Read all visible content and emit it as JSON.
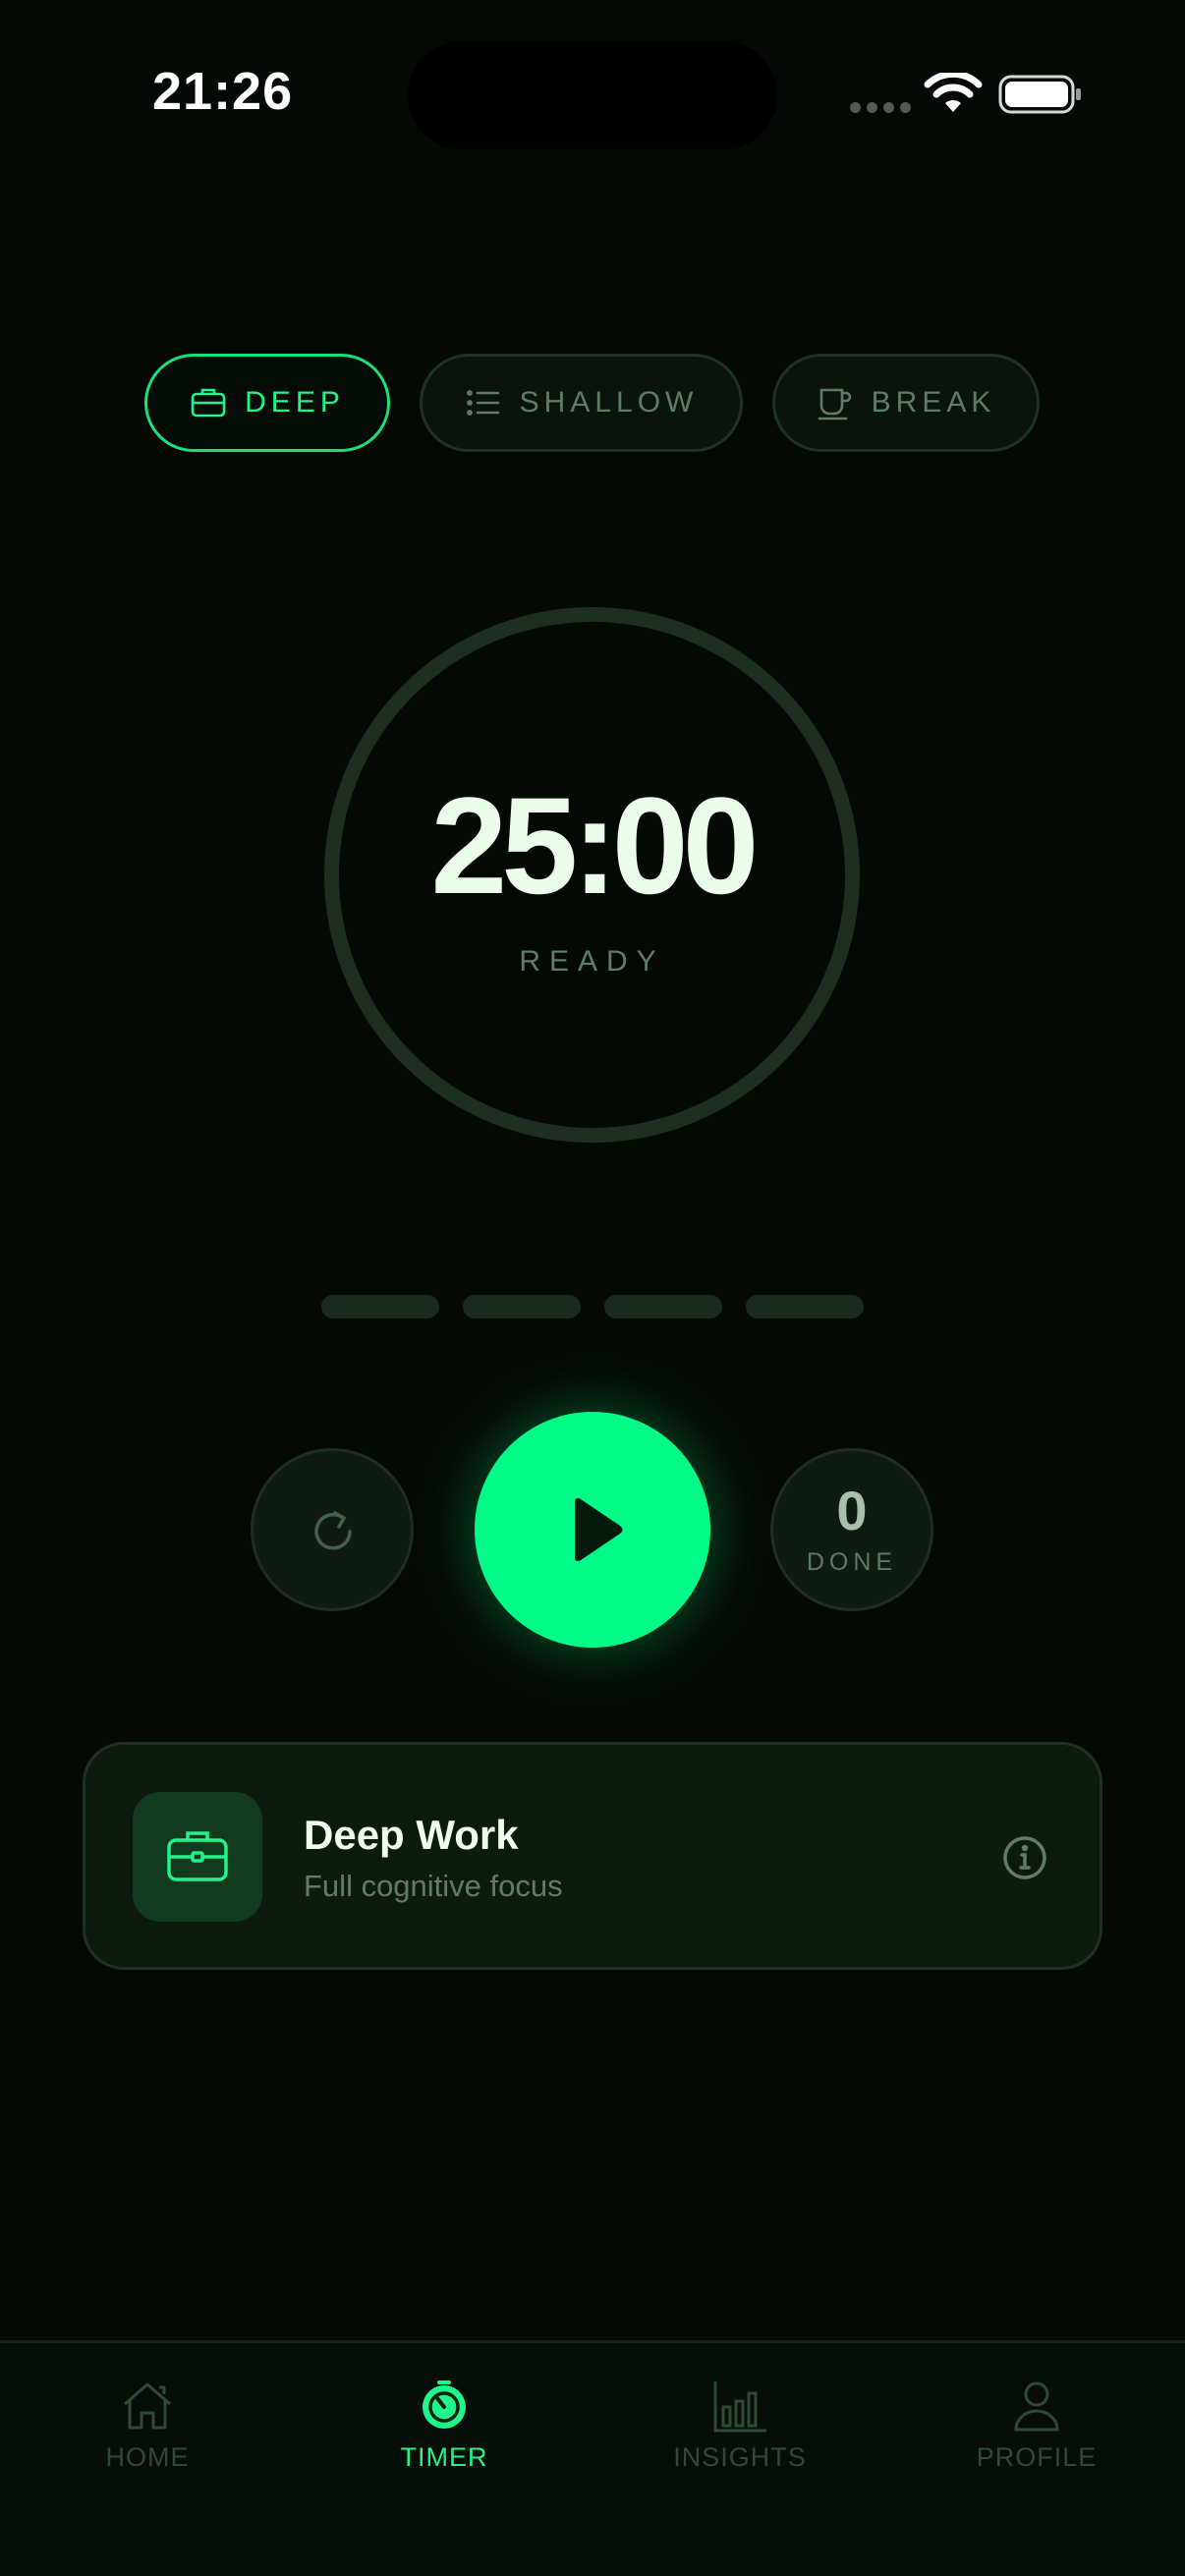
{
  "status_bar": {
    "time": "21:26"
  },
  "modes": [
    {
      "label": "DEEP",
      "icon": "briefcase-icon",
      "active": true
    },
    {
      "label": "SHALLOW",
      "icon": "list-icon",
      "active": false
    },
    {
      "label": "BREAK",
      "icon": "coffee-cup-icon",
      "active": false
    }
  ],
  "timer": {
    "time": "25:00",
    "state": "READY"
  },
  "sessions": {
    "total": 4,
    "completed": 0
  },
  "controls": {
    "reset_icon": "reset-icon",
    "play_icon": "play-icon",
    "done_count": "0",
    "done_label": "DONE"
  },
  "mode_card": {
    "title": "Deep Work",
    "subtitle": "Full cognitive focus",
    "icon": "briefcase-icon",
    "info_icon": "info-icon"
  },
  "nav": {
    "items": [
      {
        "label": "HOME",
        "icon": "home-icon"
      },
      {
        "label": "TIMER",
        "icon": "timer-icon",
        "active": true
      },
      {
        "label": "INSIGHTS",
        "icon": "bar-chart-icon"
      },
      {
        "label": "PROFILE",
        "icon": "person-icon"
      }
    ]
  },
  "colors": {
    "accent": "#02fb88",
    "background": "#050905",
    "card": "#0c1a10",
    "muted_text": "#5f7d67"
  }
}
